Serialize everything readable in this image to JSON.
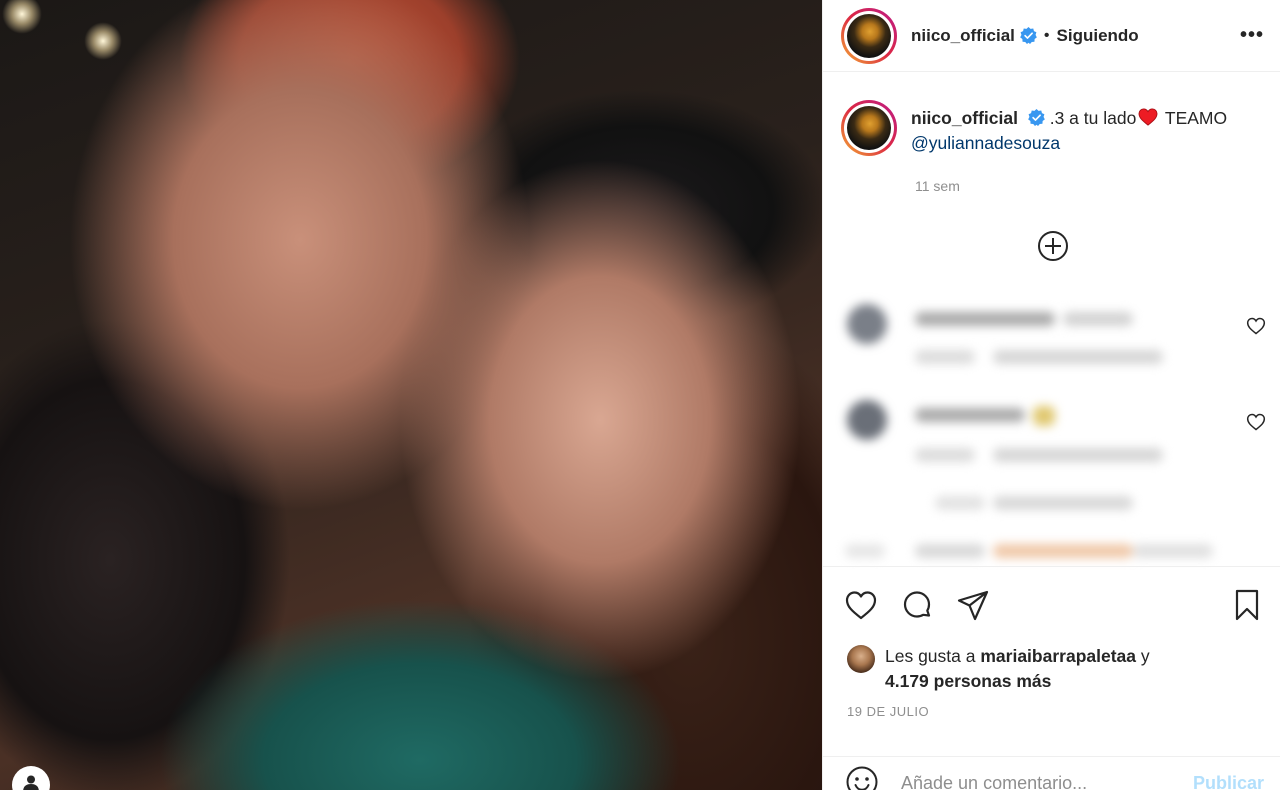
{
  "post": {
    "username": "niico_official",
    "follow_status": "Siguiendo",
    "separator": "•",
    "more_label": "•••"
  },
  "caption": {
    "username": "niico_official",
    "text_before": ".3 a tu lado",
    "emoji": "red-heart",
    "text_after": " TEAMO",
    "mention": "@yuliannadesouza",
    "time_ago": "11 sem"
  },
  "likes": {
    "prefix": "Les gusta a ",
    "user": "mariaibarrapaletaa",
    "connector": " y",
    "count": "4.179 personas más"
  },
  "date": "19 DE JULIO",
  "comment_box": {
    "placeholder": "Añade un comentario...",
    "publish_label": "Publicar"
  },
  "colors": {
    "verified": "#3897f0",
    "link": "#00376b",
    "muted": "#8e8e8e",
    "publish_disabled": "#b2dffc",
    "heart": "#ed1c24"
  },
  "icons": [
    "verified-icon",
    "more-icon",
    "add-circle-icon",
    "like-icon",
    "comment-icon",
    "share-icon",
    "save-icon",
    "emoji-icon",
    "user-icon"
  ]
}
